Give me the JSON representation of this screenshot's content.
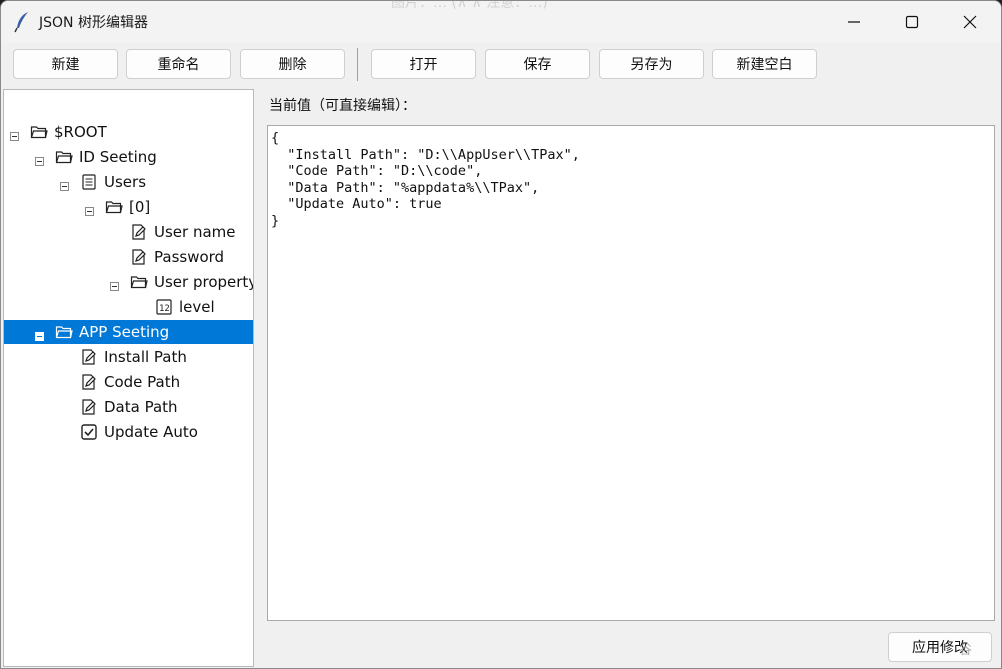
{
  "window": {
    "title": "JSON 树形编辑器",
    "faded_caption": "图片：… (∧ ∧ 注意：…)"
  },
  "toolbar": {
    "new": "新建",
    "rename": "重命名",
    "delete": "删除",
    "open": "打开",
    "save": "保存",
    "save_as": "另存为",
    "new_blank": "新建空白"
  },
  "tree": {
    "nodes": [
      {
        "label": "$ROOT",
        "icon": "folder-icon",
        "expander": "minus"
      },
      {
        "label": "ID Seeting",
        "icon": "folder-icon",
        "expander": "minus"
      },
      {
        "label": "Users",
        "icon": "list-icon",
        "expander": "minus"
      },
      {
        "label": "[0]",
        "icon": "folder-icon",
        "expander": "minus"
      },
      {
        "label": "User name",
        "icon": "edit-icon",
        "expander": ""
      },
      {
        "label": "Password",
        "icon": "edit-icon",
        "expander": ""
      },
      {
        "label": "User property",
        "icon": "folder-icon",
        "expander": "minus"
      },
      {
        "label": "level",
        "icon": "number-icon",
        "expander": ""
      },
      {
        "label": "APP Seeting",
        "icon": "folder-icon",
        "expander": "minus",
        "selected": true
      },
      {
        "label": "Install Path",
        "icon": "edit-icon",
        "expander": ""
      },
      {
        "label": "Code Path",
        "icon": "edit-icon",
        "expander": ""
      },
      {
        "label": "Data Path",
        "icon": "edit-icon",
        "expander": ""
      },
      {
        "label": "Update Auto",
        "icon": "checkbox-icon",
        "expander": ""
      }
    ],
    "selected_color": "#0078d7"
  },
  "editor": {
    "label": "当前值（可直接编辑）：",
    "content": "{\n  \"Install Path\": \"D:\\\\AppUser\\\\TPax\",\n  \"Code Path\": \"D:\\\\code\",\n  \"Data Path\": \"%appdata%\\\\TPax\",\n  \"Update Auto\": true\n}"
  },
  "apply_button": "应用修改",
  "watermark": "谷"
}
